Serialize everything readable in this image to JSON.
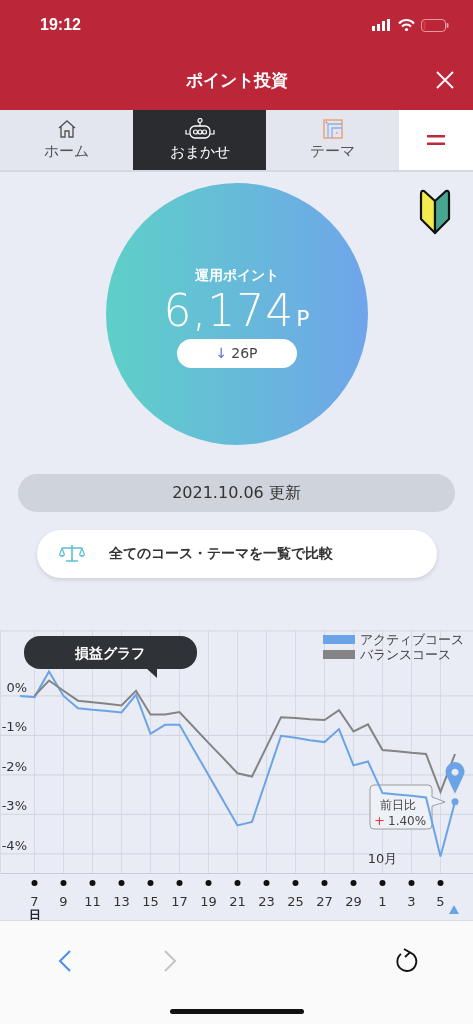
{
  "status_bar": {
    "time": "19:12"
  },
  "header": {
    "title": "ポイント投資"
  },
  "tabs": [
    {
      "kind": "home",
      "label": "ホーム",
      "selected": false
    },
    {
      "kind": "robot",
      "label": "おまかせ",
      "selected": true
    },
    {
      "kind": "theme",
      "label": "テーマ",
      "selected": false
    },
    {
      "kind": "menu",
      "selected": false
    }
  ],
  "points": {
    "label": "運用ポイント",
    "value": "6,174",
    "unit": "P",
    "change_arrow": "↓",
    "change": "26P"
  },
  "updated": "2021.10.06 更新",
  "compare_button": "全てのコース・テーマを一覧で比較",
  "chart": {
    "badge": "損益グラフ",
    "month_label": "10月",
    "weekday_label": "日",
    "tooltip": {
      "label": "前日比",
      "sign": "+",
      "value": "1.40%"
    },
    "chart_data": {
      "type": "line",
      "categories": [
        null,
        "7",
        null,
        "9",
        null,
        "11",
        null,
        "13",
        null,
        "15",
        null,
        "17",
        null,
        "19",
        null,
        "21",
        null,
        "23",
        null,
        "25",
        null,
        "27",
        null,
        "29",
        null,
        "1",
        null,
        "3",
        null,
        "5",
        null
      ],
      "grid": true,
      "legend": "upper right",
      "series": [
        {
          "name": "アクティブコース",
          "color": "#6aa3e6",
          "values": [
            0.0,
            -0.03,
            0.62,
            0.0,
            -0.31,
            -0.35,
            -0.38,
            -0.42,
            0.03,
            -0.96,
            -0.73,
            -0.73,
            -1.37,
            -2.0,
            -2.64,
            -3.28,
            -3.19,
            -2.1,
            -1.01,
            -1.06,
            -1.12,
            -1.17,
            -0.84,
            -1.76,
            -1.66,
            -2.46,
            -2.5,
            -2.53,
            -2.57,
            -4.07,
            -2.68
          ]
        },
        {
          "name": "バランスコース",
          "color": "#848484",
          "values": [
            null,
            0.0,
            0.39,
            0.13,
            -0.12,
            -0.16,
            -0.2,
            -0.24,
            0.13,
            -0.47,
            -0.47,
            -0.41,
            -0.8,
            -1.19,
            -1.57,
            -1.96,
            -2.04,
            -1.29,
            -0.54,
            -0.56,
            -0.59,
            -0.61,
            -0.36,
            -0.9,
            -0.72,
            -1.37,
            -1.4,
            -1.44,
            -1.47,
            -2.43,
            -1.47
          ]
        }
      ],
      "ylim": [
        -4.51,
        1.67
      ],
      "yticks": [
        {
          "value": 0,
          "label": "0%"
        },
        {
          "value": -1,
          "label": "-1%"
        },
        {
          "value": -2,
          "label": "-2%"
        },
        {
          "value": -3,
          "label": "-3%"
        },
        {
          "value": -4,
          "label": "-4%"
        }
      ]
    }
  },
  "toolbar": {
    "back": {
      "disabled": false
    },
    "forward": {
      "disabled": true
    }
  }
}
